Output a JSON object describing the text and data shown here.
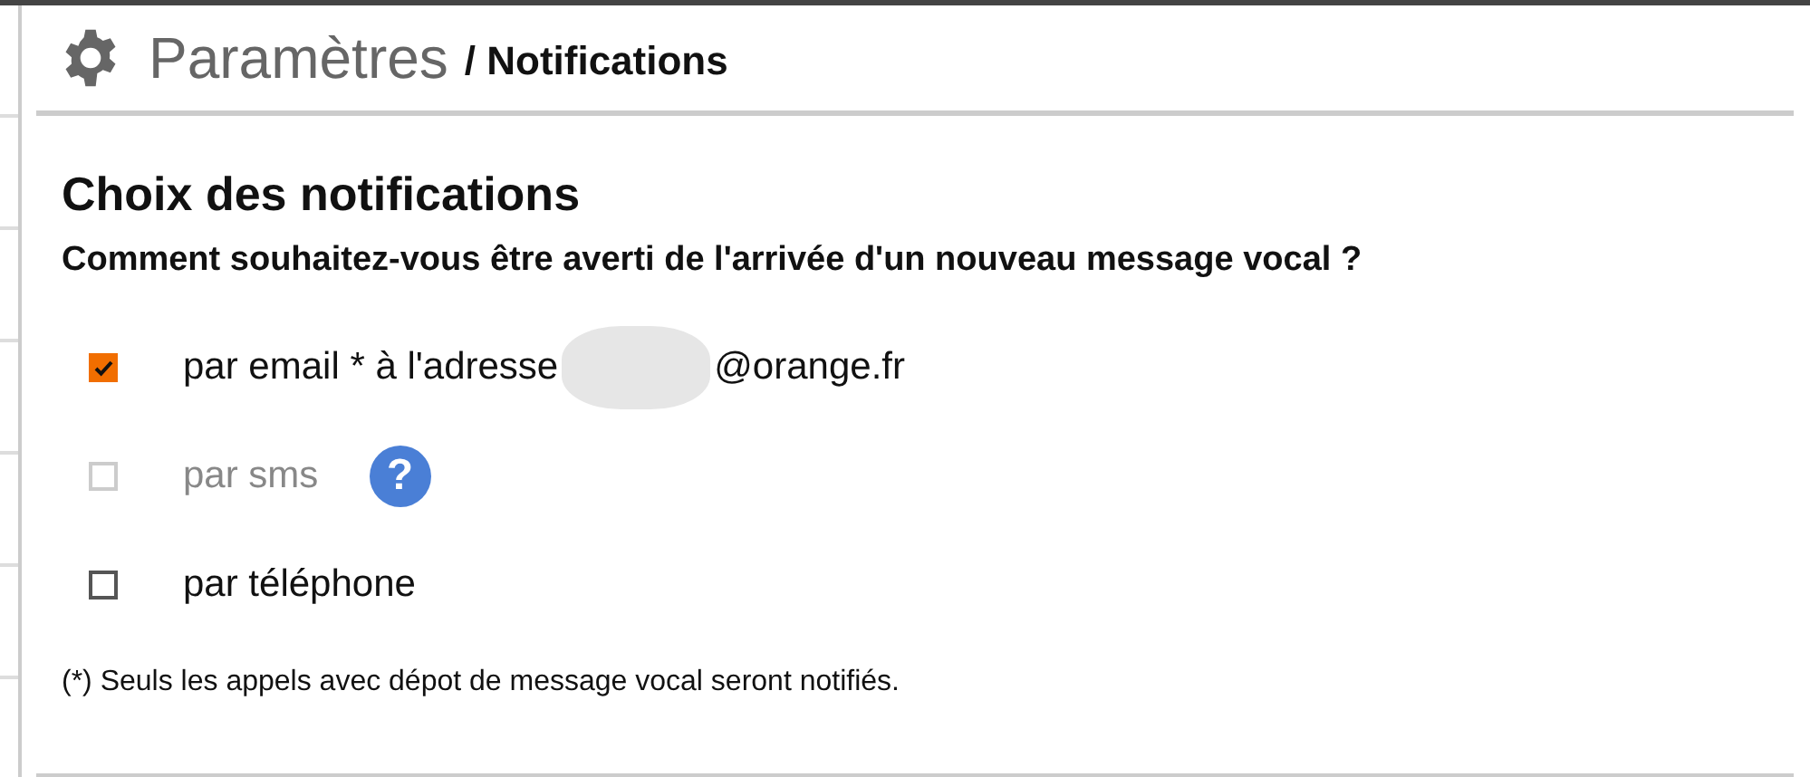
{
  "header": {
    "title": "Paramètres",
    "subtitle": "/ Notifications"
  },
  "section": {
    "heading": "Choix des notifications",
    "question": "Comment souhaitez-vous être averti de l'arrivée d'un nouveau message vocal ?"
  },
  "options": [
    {
      "label": "par email * à l'adresse",
      "address_domain": "@orange.fr",
      "checked": true,
      "disabled": false
    },
    {
      "label": "par sms",
      "help": "?",
      "checked": false,
      "disabled": true
    },
    {
      "label": "par téléphone",
      "checked": false,
      "disabled": false
    }
  ],
  "footnote": "(*) Seuls les appels avec dépot de message vocal seront notifiés."
}
